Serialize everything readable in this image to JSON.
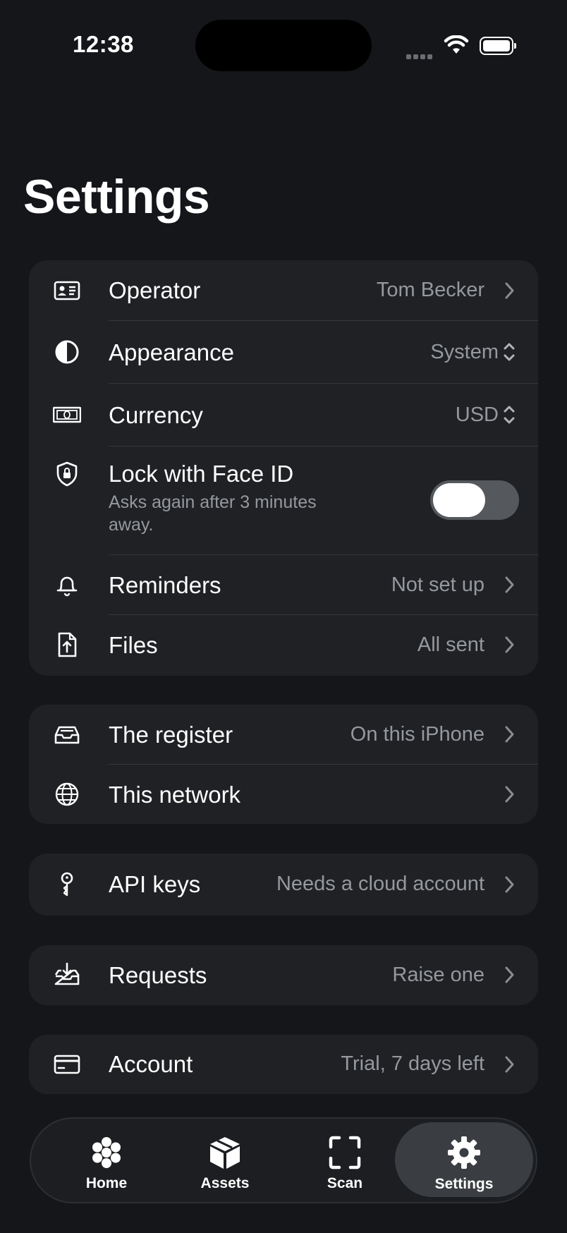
{
  "status_bar": {
    "time": "12:38"
  },
  "title": "Settings",
  "groups": [
    [
      {
        "label": "Operator",
        "value": "Tom Becker",
        "icon": "id-card-icon"
      },
      {
        "label": "Appearance",
        "value": "System",
        "icon": "half-circle-icon"
      },
      {
        "label": "Currency",
        "value": "USD",
        "icon": "banknote-icon"
      },
      {
        "label": "Lock with Face ID",
        "sublabel": "Asks again after 3 minutes away.",
        "toggle_on": false,
        "icon": "shield-lock-icon"
      },
      {
        "label": "Reminders",
        "value": "Not set up",
        "icon": "bell-icon"
      },
      {
        "label": "Files",
        "value": "All sent",
        "icon": "file-upload-icon"
      }
    ],
    [
      {
        "label": "The register",
        "value": "On this iPhone",
        "icon": "tray-icon"
      },
      {
        "label": "This network",
        "value": "",
        "icon": "globe-icon"
      }
    ],
    [
      {
        "label": "API keys",
        "value": "Needs a cloud account",
        "icon": "key-icon"
      }
    ],
    [
      {
        "label": "Requests",
        "value": "Raise one",
        "icon": "tray-download-icon"
      }
    ],
    [
      {
        "label": "Account",
        "value": "Trial, 7 days left",
        "icon": "credit-card-icon"
      }
    ]
  ],
  "tabs": [
    {
      "label": "Home",
      "icon": "flower-icon",
      "active": false
    },
    {
      "label": "Assets",
      "icon": "box-icon",
      "active": false
    },
    {
      "label": "Scan",
      "icon": "scan-frame-icon",
      "active": false
    },
    {
      "label": "Settings",
      "icon": "gear-icon",
      "active": true
    }
  ],
  "colors": {
    "background": "#141619",
    "card": "#1f2124",
    "secondary_text": "#95989d"
  }
}
